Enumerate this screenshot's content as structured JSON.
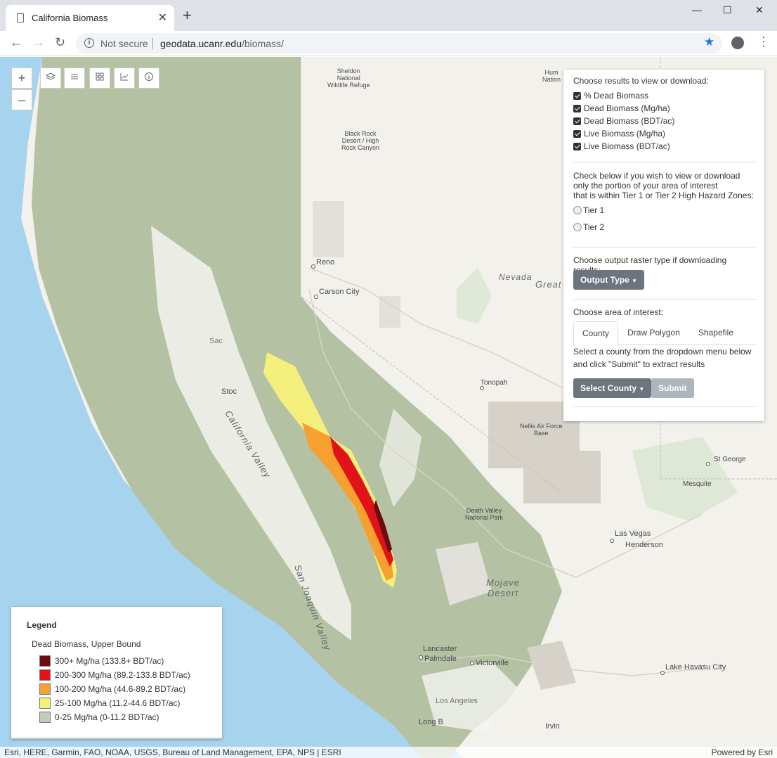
{
  "browser": {
    "tab_title": "California Biomass",
    "new_tab": "+",
    "tab_close": "✕",
    "security": "Not secure",
    "url_host": "geodata.ucanr.edu",
    "url_path": "/biomass/",
    "window_controls": {
      "minimize": "—",
      "maximize": "☐",
      "close": "✕"
    }
  },
  "map_controls": {
    "zoom_in": "+",
    "zoom_out": "–"
  },
  "map_labels": {
    "sheldon": "Sheldon\nNational\nWildlife Refuge",
    "humboldt": "Hum\nNation",
    "black_rock": "Black Rock\nDesert / High\nRock Canyon",
    "reno": "Reno",
    "carson_city": "Carson City",
    "nevada": "Nevada",
    "great": "Great",
    "tonopah": "Tonopah",
    "nellis": "Nellis Air Force\nBase",
    "st_george": "St George",
    "mesquite": "Mesquite",
    "death_valley": "Death Valley\nNational Park",
    "las_vegas": "Las Vegas",
    "henderson": "Henderson",
    "mojave": "Mojave\nDesert",
    "lancaster": "Lancaster",
    "palmdale": "Palmdale",
    "victorville": "Victorville",
    "lake_havasu": "Lake Havasu City",
    "los_angeles": "Los Angeles",
    "long_beach": "Long B",
    "irvine": "Irvin",
    "stockton": "Stoc",
    "sacramento": "Sac",
    "san_joaquin": "San Joaquin Valley",
    "central_valley": "California Valley"
  },
  "panel": {
    "results_heading": "Choose results to view or download:",
    "results": [
      {
        "label": "% Dead Biomass",
        "checked": true
      },
      {
        "label": "Dead Biomass (Mg/ha)",
        "checked": true
      },
      {
        "label": "Dead Biomass (BDT/ac)",
        "checked": true
      },
      {
        "label": "Live Biomass (Mg/ha)",
        "checked": true
      },
      {
        "label": "Live Biomass (BDT/ac)",
        "checked": true
      }
    ],
    "tier_text_1": "Check below if you wish to view or download",
    "tier_text_2": "only the portion of your area of interest",
    "tier_text_3": "that is within Tier 1 or Tier 2 High Hazard Zones:",
    "tier1": "Tier 1",
    "tier2": "Tier 2",
    "output_heading": "Choose output raster type if downloading results:",
    "output_button": "Output Type",
    "area_heading": "Choose area of interest:",
    "tabs": [
      "County",
      "Draw Polygon",
      "Shapefile"
    ],
    "county_text_1": "Select a county from the dropdown menu below",
    "county_text_2": "and click \"Submit\" to extract results",
    "select_county_button": "Select County",
    "submit_button": "Submit"
  },
  "legend": {
    "title": "Legend",
    "subtitle": "Dead Biomass, Upper Bound",
    "items": [
      {
        "label": "300+ Mg/ha (133.8+ BDT/ac)",
        "color": "#6b0a10"
      },
      {
        "label": "200-300 Mg/ha (89.2-133.8 BDT/ac)",
        "color": "#e0131b"
      },
      {
        "label": "100-200 Mg/ha (44.6-89.2 BDT/ac)",
        "color": "#f7a030"
      },
      {
        "label": "25-100 Mg/ha (11.2-44.6 BDT/ac)",
        "color": "#f5f07c"
      },
      {
        "label": "0-25 Mg/ha (0-11.2 BDT/ac)",
        "color": "#c3cdb5"
      }
    ]
  },
  "attribution": {
    "left": "Esri, HERE, Garmin, FAO, NOAA, USGS, Bureau of Land Management, EPA, NPS | ESRI",
    "right": "Powered by Esri"
  },
  "colors": {
    "ocean": "#a6d3ee",
    "land": "#f2f1ec",
    "biomass_green": "#b4c1a3",
    "accent_star": "#1a73e8"
  }
}
